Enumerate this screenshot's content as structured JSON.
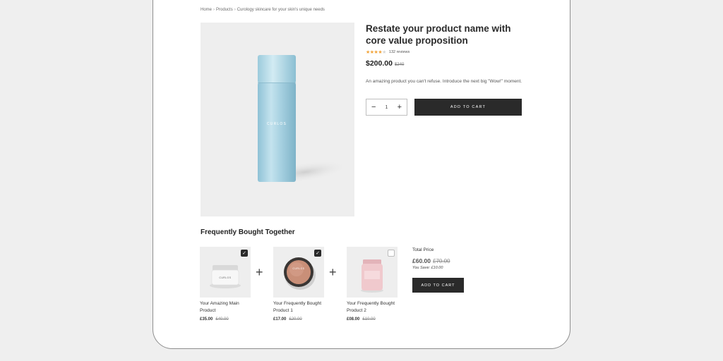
{
  "breadcrumb": {
    "home": "Home",
    "sep": "›",
    "products": "Products",
    "current": "Curology skincare for your skin's unique needs"
  },
  "product": {
    "image_brand": "CURLOS",
    "title": "Restate your product name with core value proposition",
    "rating_stars": 4,
    "rating_max": 5,
    "reviews": "132 reviews",
    "price": "$200.00",
    "old_price": "$240",
    "description": "An amazing product you can't refuse. Introduce the next big \"Wow!\" moment.",
    "quantity": "1",
    "qty_minus": "−",
    "qty_plus": "+",
    "add_to_cart": "ADD TO CART"
  },
  "fbt": {
    "title": "Frequently Bought Together",
    "plus_sign": "+",
    "check_mark": "✓",
    "items": [
      {
        "name": "Your Amazing Main Product",
        "price": "£35.00",
        "old_price": "£40.00",
        "checked": true,
        "image_brand": "CURLOS"
      },
      {
        "name": "Your Frequently Bought Product 1",
        "price": "£17.00",
        "old_price": "£20.00",
        "checked": true,
        "image_brand": "CURLOS"
      },
      {
        "name": "Your Frequently Bought Product 2",
        "price": "£08.00",
        "old_price": "£10.00",
        "checked": false,
        "image_brand": ""
      }
    ],
    "total_label": "Total Price",
    "total_price": "£60.00",
    "total_old": "£70.00",
    "you_save": "You Save: £10.00",
    "add_to_cart": "ADD TO CART"
  },
  "colors": {
    "accent_button": "#2a2a2a",
    "star": "#f2a43a",
    "bottle": "#a9d3e2",
    "jar_pink": "#f0c9cd",
    "compact_bronze": "#c98f78"
  }
}
